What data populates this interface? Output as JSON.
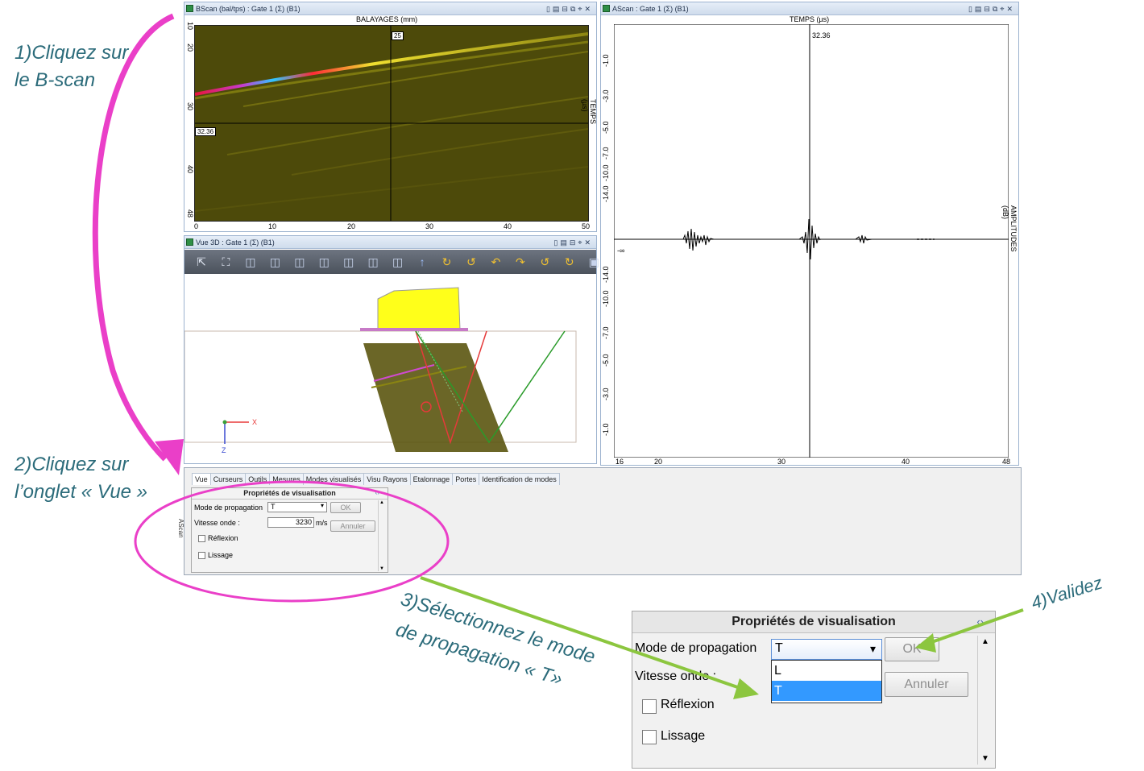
{
  "annotations": {
    "step1_line1": "1)Cliquez sur",
    "step1_line2": "le B-scan",
    "step2_line1": "2)Cliquez sur",
    "step2_line2": "l’onglet « Vue »",
    "step3_line1": "3)Sélectionnez le mode",
    "step3_line2": "de propagation « T»",
    "step4": "4)Validez",
    "colors": {
      "magenta": "#ea3fc8",
      "green": "#8cc63f",
      "teal_text": "#2b6b7a"
    }
  },
  "bscan": {
    "title": "BScan (bal/tps) : Gate 1 (Σ) (B1)",
    "x_axis_title": "BALAYAGES (mm)",
    "y_axis_title": "TEMPS (µs)",
    "x_ticks": [
      "0",
      "10",
      "20",
      "30",
      "40",
      "50"
    ],
    "y_ticks": [
      "10",
      "20",
      "30",
      "40",
      "48"
    ],
    "cursor_x_label": "25",
    "cursor_y_label": "32.36",
    "background_color": "#4d4a0a"
  },
  "vue3d": {
    "title": "Vue 3D : Gate 1 (Σ) (B1)",
    "axis_x": "X",
    "axis_z": "Z",
    "toolbar_icons": [
      "pointer-icon",
      "fit-icon",
      "cube-front-icon",
      "cube-back-icon",
      "cube-left-icon",
      "cube-right-icon",
      "cube-top-icon",
      "cube-bottom-icon",
      "cube-iso-icon",
      "arrow-up-icon",
      "rotate-1-icon",
      "rotate-2-icon",
      "rotate-3-icon",
      "rotate-4-icon",
      "rotate-5-icon",
      "rotate-6-icon",
      "cube-wire-1-icon",
      "cube-wire-2-icon",
      "cube-wire-3-icon"
    ]
  },
  "ascan": {
    "title": "AScan : Gate 1 (Σ) (B1)",
    "top_axis_title": "TEMPS (µs)",
    "right_axis_title": "AMPLITUDES (dB)",
    "cursor_label": "32.36",
    "x_ticks": [
      "16",
      "20",
      "30",
      "40",
      "48"
    ],
    "y_ticks_top": [
      "-1.0",
      "-3.0",
      "-5.0",
      "-7.0",
      "-10.0",
      "-14.0"
    ],
    "y_ticks_bottom": [
      "-14.0",
      "-10.0",
      "-7.0",
      "-5.0",
      "-3.0",
      "-1.0"
    ],
    "y_center": "-∞"
  },
  "tabs": [
    "Vue",
    "Curseurs",
    "Outils",
    "Mesures",
    "Modes visualisés",
    "Visu Rayons",
    "Etalonnage",
    "Portes",
    "Identification de modes"
  ],
  "active_tab": "Vue",
  "side_label": "AScan",
  "props_small": {
    "title": "Propriétés de visualisation",
    "mode_label": "Mode de propagation",
    "mode_value": "T",
    "speed_label": "Vitesse onde :",
    "speed_value": "3230",
    "speed_unit": "m/s",
    "ok": "OK",
    "cancel": "Annuler",
    "reflexion": "Réflexion",
    "lissage": "Lissage"
  },
  "props_zoom": {
    "title": "Propriétés de visualisation",
    "mode_label": "Mode de propagation",
    "mode_value": "T",
    "speed_label": "Vitesse onde :",
    "ok": "OK",
    "cancel": "Annuler",
    "reflexion": "Réflexion",
    "lissage": "Lissage",
    "options": [
      "L",
      "T"
    ],
    "selected_option": "T",
    "highlight_color": "#3399ff"
  }
}
